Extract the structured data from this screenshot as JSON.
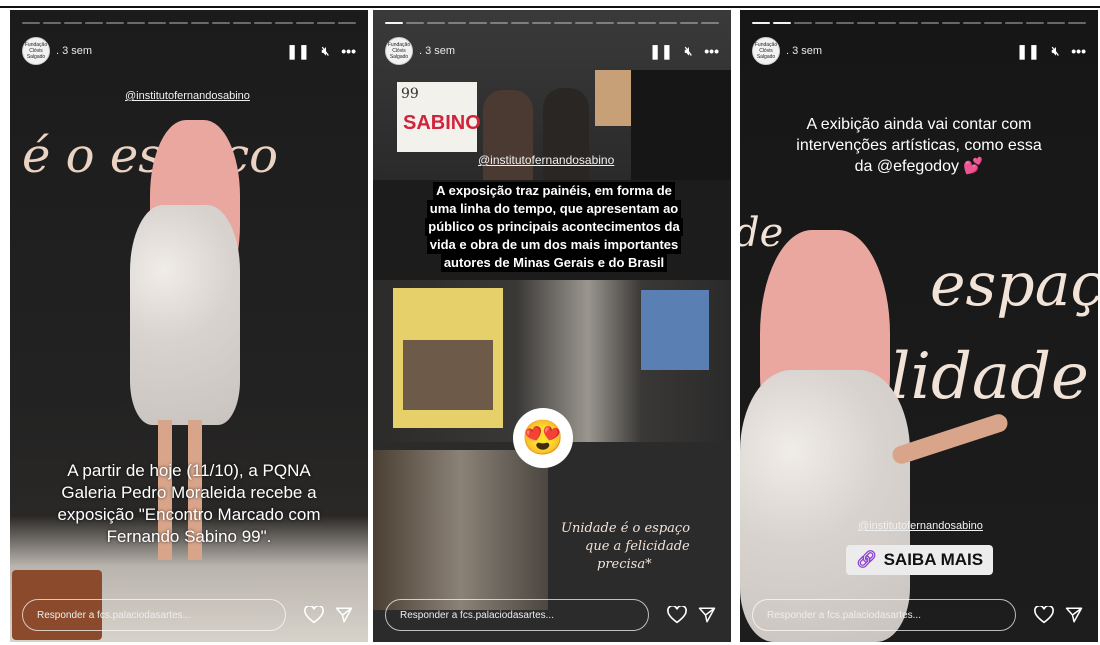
{
  "stories": [
    {
      "time": ". 3 sem",
      "mention": "@institutofernandosabino",
      "wall_text": "é o espaço",
      "caption_lines": [
        "A partir de hoje (11/10), a PQNA",
        "Galeria Pedro Moraleida recebe a",
        "exposição \"Encontro Marcado com",
        "Fernando Sabino 99\"."
      ],
      "reply_placeholder": "Responder a fcs.palaciodasartes..."
    },
    {
      "time": ". 3 sem",
      "mention": "@institutofernandosabino",
      "poster_text": "SABINO",
      "poster_number": "99",
      "text_lines": [
        "A exposição traz painéis, em forma de",
        "uma linha do tempo, que apresentam ao",
        "público os principais acontecimentos da",
        "vida e obra de um dos mais importantes",
        "autores de Minas Gerais e do Brasil"
      ],
      "emoji": "😍",
      "wall_lines": [
        "Unidade é o espaço",
        "que a felicidade",
        "precisa*"
      ],
      "reply_placeholder": "Responder a fcs.palaciodasartes..."
    },
    {
      "time": ". 3 sem",
      "caption_lines": [
        "A exibição ainda vai contar com",
        "intervenções artísticas, como essa",
        "da @efegodoy 💕"
      ],
      "wall_text_1": "espaç",
      "wall_text_2": "lidade",
      "wall_text_3": "de",
      "mention": "@institutofernandosabino",
      "link_label": "SAIBA MAIS",
      "reply_placeholder": "Responder a fcs.palaciodasartes..."
    }
  ],
  "avatar_text": "Fundação Clóvis Salgado"
}
